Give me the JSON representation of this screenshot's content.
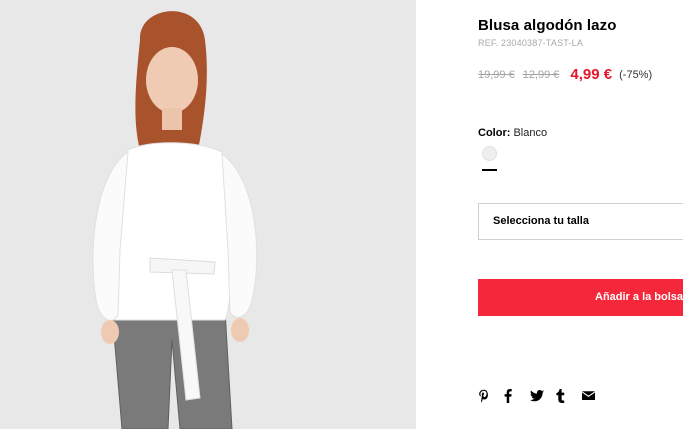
{
  "product": {
    "title": "Blusa algodón lazo",
    "ref": "REF. 23040387-TAST-LA"
  },
  "prices": {
    "original": "19,99 €",
    "previous": "12,99 €",
    "current": "4,99 €",
    "discount": "(-75%)"
  },
  "color": {
    "label": "Color:",
    "value": "Blanco",
    "swatch_hex": "#efefef"
  },
  "size": {
    "placeholder": "Selecciona tu talla"
  },
  "cart": {
    "add_label": "Añadir a la bolsa"
  },
  "share_icons": [
    "pinterest-icon",
    "facebook-icon",
    "twitter-icon",
    "tumblr-icon",
    "email-icon"
  ],
  "colors": {
    "price_red": "#e5162d",
    "button_red": "#f5283b"
  }
}
